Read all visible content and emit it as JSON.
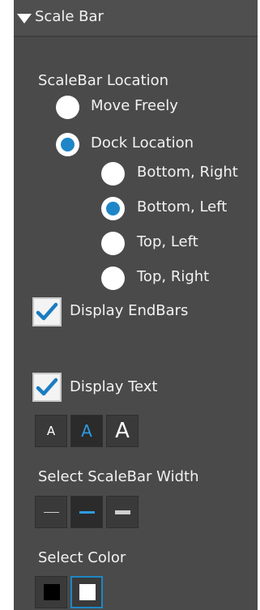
{
  "panel": {
    "title": "Scale Bar"
  },
  "location": {
    "heading": "ScaleBar Location",
    "options": [
      {
        "label": "Move Freely",
        "selected": false
      },
      {
        "label": "Dock Location",
        "selected": true
      }
    ],
    "dock_options": [
      {
        "label": "Bottom, Right",
        "selected": false
      },
      {
        "label": "Bottom, Left",
        "selected": true
      },
      {
        "label": "Top, Left",
        "selected": false
      },
      {
        "label": "Top, Right",
        "selected": false
      }
    ]
  },
  "display_endbars": {
    "label": "Display EndBars",
    "checked": true
  },
  "display_text": {
    "label": "Display Text",
    "checked": true
  },
  "text_size": {
    "options": [
      "A",
      "A",
      "A"
    ],
    "selected_index": 1
  },
  "width": {
    "heading": "Select ScaleBar Width",
    "selected_index": 1
  },
  "color": {
    "heading": "Select Color",
    "swatches": [
      {
        "name": "black",
        "hex": "#000000",
        "selected": false
      },
      {
        "name": "white",
        "hex": "#ffffff",
        "selected": true
      }
    ]
  },
  "colors": {
    "accent": "#1e86c7",
    "panel_bg": "#4a4a4a",
    "check_blue": "#1a7cc0"
  }
}
